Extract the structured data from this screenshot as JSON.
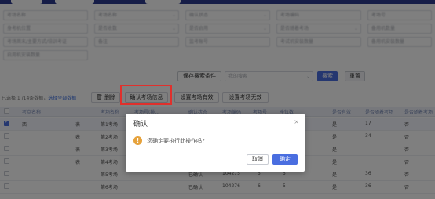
{
  "filters": {
    "row1": [
      "考场名称",
      "考场名称",
      "确认状态",
      "考场编码",
      "考场号"
    ],
    "row2": [
      "身考机位置",
      "是否收数",
      "是否启用",
      "是否随着考场",
      "备用机数量"
    ],
    "row3": [
      "考场周末/主要方式/培训考证",
      "备注",
      "监考账号",
      "考试机安装数量",
      "备用机安装数量"
    ],
    "row4": [
      "启用机安装数量"
    ]
  },
  "search": {
    "save_button": "保存搜索条件",
    "saved_placeholder": "我的搜索",
    "search_button": "搜索",
    "reset_button": "重置"
  },
  "toolbar": {
    "selection_info": "已选择 1 /14条数据，",
    "select_all_link": "选择全部数据",
    "delete_button": "删除",
    "confirm_info_button": "确认考场信息",
    "set_valid_button": "设置考场有效",
    "set_invalid_button": "设置考场无效"
  },
  "table": {
    "headers": [
      "考点名称",
      "考场名称",
      "考场号(排...",
      "确认状态",
      "考场编码",
      "考场号",
      "座位数",
      "是否有效",
      "是否随着考场",
      "是否随着考场"
    ],
    "rows": [
      {
        "checked": true,
        "c1": "西",
        "c2": "表",
        "c3": "第1考场",
        "c4": "",
        "c5": "",
        "c6": "",
        "c7": "",
        "c8": "是",
        "c9": "17",
        "c10": "否"
      },
      {
        "checked": false,
        "c1": "",
        "c2": "表",
        "c3": "第2考场",
        "c4": "",
        "c5": "",
        "c6": "",
        "c7": "",
        "c8": "是",
        "c9": "34",
        "c10": "否"
      },
      {
        "checked": false,
        "c1": "",
        "c2": "表",
        "c3": "第3考场",
        "c4": "",
        "c5": "",
        "c6": "",
        "c7": "",
        "c8": "是",
        "c9": "",
        "c10": "否"
      },
      {
        "checked": false,
        "c1": "",
        "c2": "表",
        "c3": "第4考场",
        "c4": "",
        "c5": "",
        "c6": "",
        "c7": "",
        "c8": "是",
        "c9": "",
        "c10": "否"
      },
      {
        "checked": false,
        "c1": "",
        "c2": "",
        "c3": "第5考场",
        "c4": "已确认",
        "c5": "104275",
        "c6": "5",
        "c7": "5",
        "c8": "是",
        "c9": "36",
        "c10": "否"
      },
      {
        "checked": false,
        "c1": "",
        "c2": "",
        "c3": "第6考场",
        "c4": "已确认",
        "c5": "104276",
        "c6": "6",
        "c7": "5",
        "c8": "是",
        "c9": "36",
        "c10": "否"
      }
    ]
  },
  "dialog": {
    "title": "确认",
    "close": "×",
    "icon": "warning-icon",
    "message": "您确定要执行此操作吗?",
    "cancel_button": "取消",
    "ok_button": "确定"
  },
  "colors": {
    "primary": "#4a6ee0",
    "header_bar": "#2c3a8f",
    "highlight": "#e0302c",
    "warning": "#e6a23c"
  }
}
